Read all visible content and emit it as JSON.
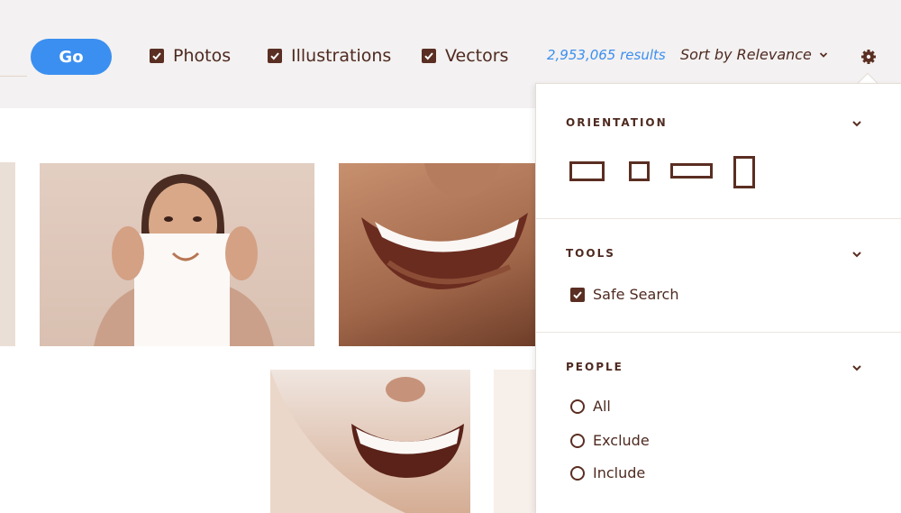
{
  "toolbar": {
    "go_label": "Go",
    "filters": [
      {
        "label": "Photos",
        "checked": true
      },
      {
        "label": "Illustrations",
        "checked": true
      },
      {
        "label": "Vectors",
        "checked": true
      }
    ],
    "results_count": "2,953,065 results",
    "sort_label": "Sort by Relevance",
    "settings_icon": "gear-icon"
  },
  "panel": {
    "orientation": {
      "title": "ORIENTATION",
      "options": [
        "landscape-icon",
        "square-icon",
        "panoramic-icon",
        "portrait-icon"
      ]
    },
    "tools": {
      "title": "TOOLS",
      "safe_search": {
        "label": "Safe Search",
        "checked": true
      }
    },
    "people": {
      "title": "PEOPLE",
      "options": [
        "All",
        "Exclude",
        "Include"
      ]
    }
  },
  "colors": {
    "accent": "#3b8ff0",
    "text": "#5a2e22"
  }
}
